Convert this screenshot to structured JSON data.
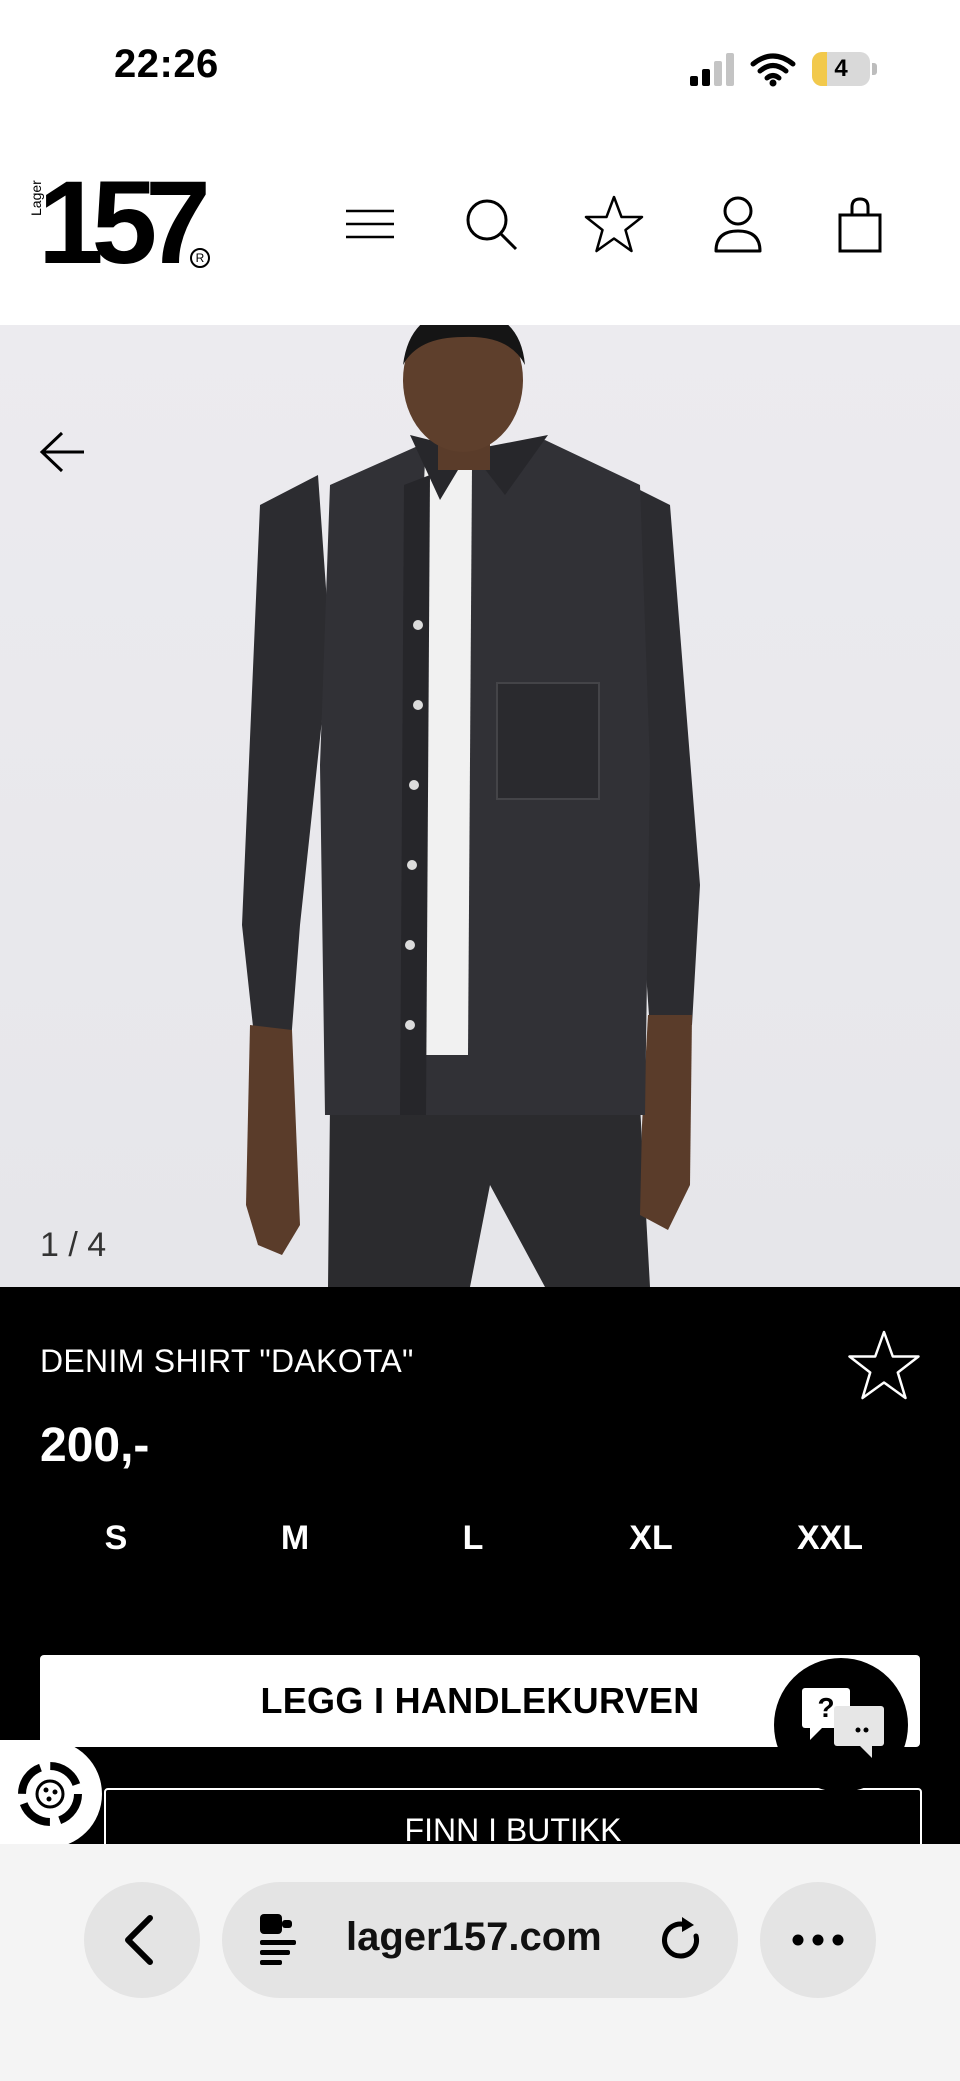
{
  "status_bar": {
    "time": "22:26",
    "battery_percent": "4",
    "battery_fill": 0.25,
    "signal_bars_active": 2
  },
  "header": {
    "logo_number": "157",
    "logo_sub": "Lager",
    "logo_reg": "R",
    "icons": [
      "menu-icon",
      "search-icon",
      "star-icon",
      "user-icon",
      "bag-icon"
    ]
  },
  "gallery": {
    "counter": "1 / 4"
  },
  "product": {
    "name": "DENIM SHIRT \"DAKOTA\"",
    "price": "200,-",
    "sizes": [
      "S",
      "M",
      "L",
      "XL",
      "XXL"
    ],
    "add_to_cart": "LEGG I HANDLEKURVEN",
    "find_in_store": "FINN I BUTIKK"
  },
  "chat": {
    "label": "?"
  },
  "browser": {
    "url": "lager157.com"
  },
  "colors": {
    "panel": "#000000",
    "image_bg": "#ebebef",
    "browser_bg": "#f4f4f4",
    "pill_bg": "#e4e4e4",
    "battery_fill": "#f2c94c"
  }
}
